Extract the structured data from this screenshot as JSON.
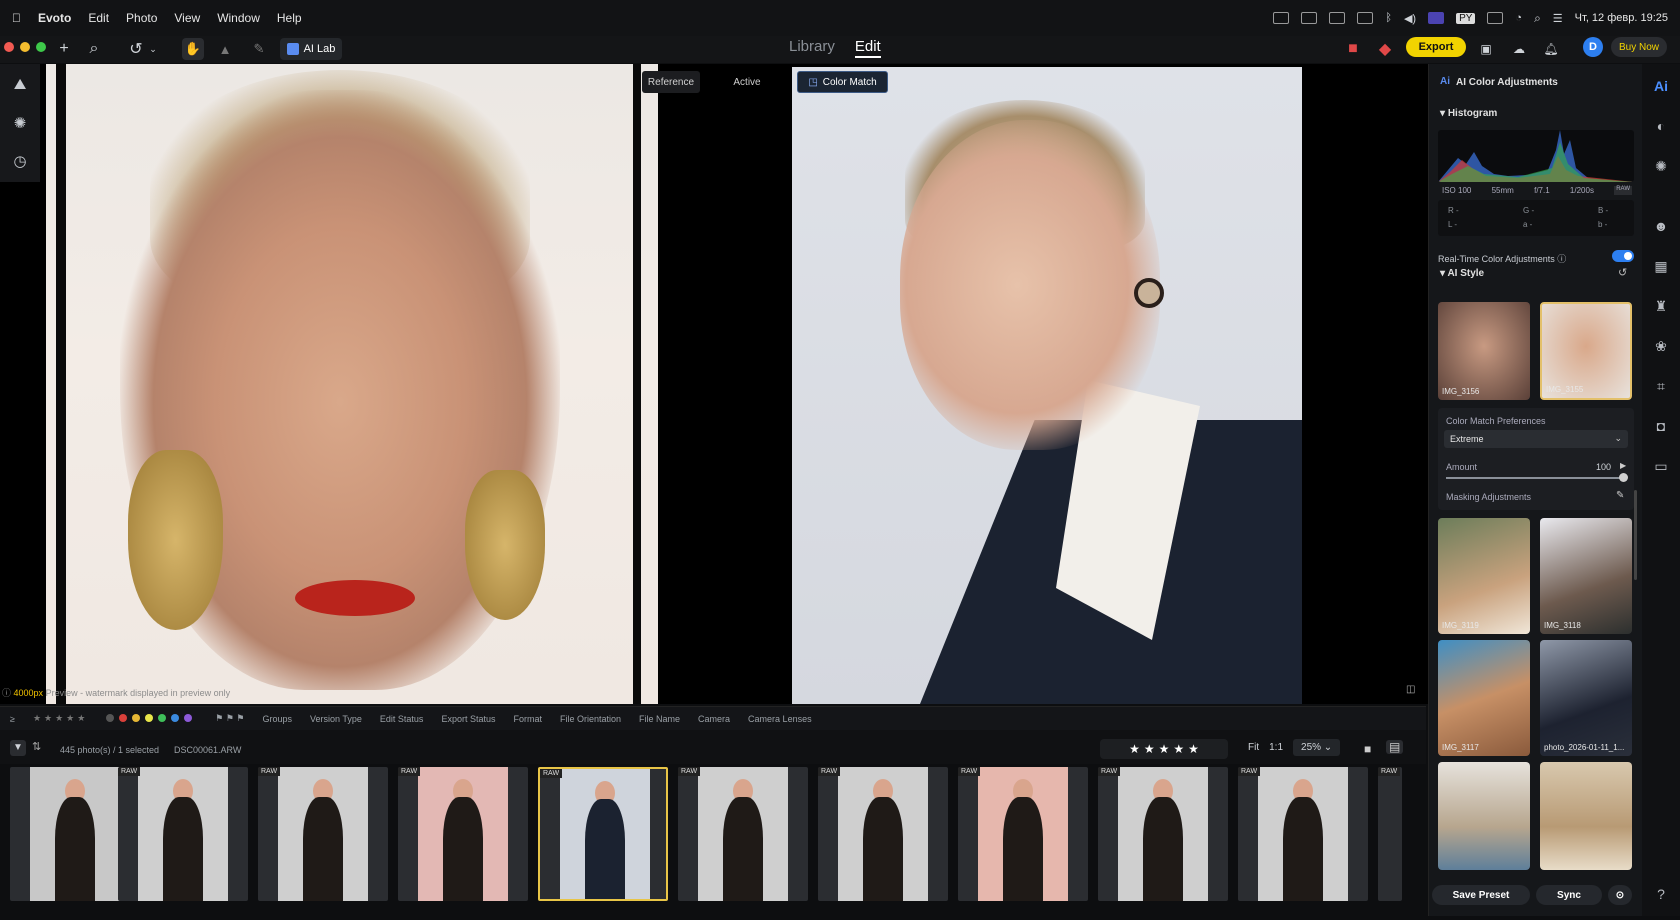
{
  "menubar": {
    "app": "Evoto",
    "items": [
      "Edit",
      "Photo",
      "View",
      "Window",
      "Help"
    ],
    "clock": "Чт, 12 февр. 19:25"
  },
  "toolbar": {
    "ailab_label": "AI Lab",
    "tabs": [
      {
        "label": "Library"
      },
      {
        "label": "Edit"
      }
    ],
    "export_label": "Export",
    "buynow_label": "Buy Now",
    "avatar_letter": "D"
  },
  "canvas": {
    "tab_reference": "Reference",
    "tab_active": "Active",
    "tab_color_match": "Color Match",
    "preview_size": "4000px",
    "preview_note": "Preview - watermark displayed in preview only"
  },
  "filterbar": {
    "items": [
      "Groups",
      "Version Type",
      "Edit Status",
      "Export Status",
      "Format",
      "File Orientation",
      "File Name",
      "Camera",
      "Camera Lenses"
    ],
    "colors": [
      "#d9403a",
      "#e6b735",
      "#e8e64a",
      "#3fbf5a",
      "#3b8be0",
      "#8d5ad8"
    ]
  },
  "infobar": {
    "count": "445 photo(s) / 1 selected",
    "filename": "DSC00061.ARW",
    "zoom_fit": "Fit",
    "zoom_11": "1:1",
    "zoom_pct": "25%"
  },
  "filmstrip": {
    "badges": [
      "RAW",
      "RAW",
      "RAW",
      "RAW",
      "RAW",
      "RAW",
      "RAW",
      "RAW",
      "RAW",
      "RAW"
    ]
  },
  "panel": {
    "title": "AI Color Adjustments",
    "histogram_label": "Histogram",
    "exif": {
      "iso": "ISO 100",
      "focal": "55mm",
      "aperture": "f/7.1",
      "shutter": "1/200s",
      "fmt": "RAW"
    },
    "rgb": {
      "r": "R -",
      "g": "G -",
      "b": "B -",
      "l": "L -",
      "a": "a -",
      "b2": "b -"
    },
    "realtime_label": "Real-Time Color Adjustments",
    "realtime_on": true,
    "ai_style_label": "AI Style",
    "styles": [
      {
        "name": "IMG_3156"
      },
      {
        "name": "IMG_3155"
      },
      {
        "name": "IMG_3119"
      },
      {
        "name": "IMG_3118"
      },
      {
        "name": "IMG_3117"
      },
      {
        "name": "photo_2026-01-11_1..."
      }
    ],
    "color_match_pref_label": "Color Match Preferences",
    "color_match_pref_value": "Extreme",
    "amount_label": "Amount",
    "amount_value": "100",
    "masking_label": "Masking Adjustments",
    "save_preset": "Save Preset",
    "sync": "Sync"
  }
}
